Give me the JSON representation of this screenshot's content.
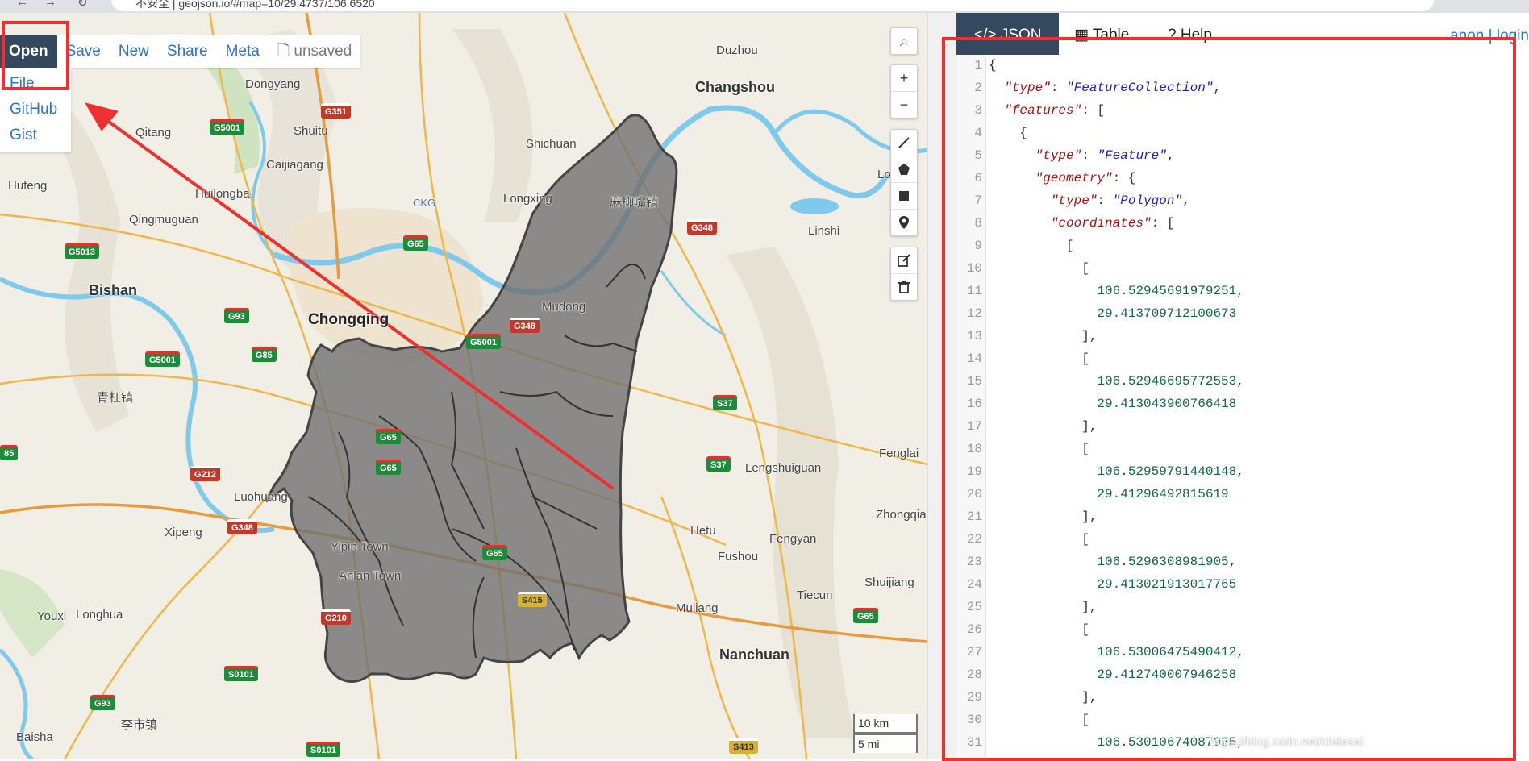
{
  "browser": {
    "url": "不安全 | geojson.io/#map=10/29.4737/106.6520"
  },
  "menu": {
    "open": "Open",
    "save": "Save",
    "new": "New",
    "share": "Share",
    "meta": "Meta",
    "unsaved": "unsaved"
  },
  "open_menu": {
    "items": [
      "File",
      "GitHub",
      "Gist"
    ]
  },
  "map": {
    "places": [
      {
        "label": "Changshou",
        "kind": "big"
      },
      {
        "label": "Chongqing",
        "kind": "city"
      },
      {
        "label": "Bishan",
        "kind": "big"
      },
      {
        "label": "Duzhou",
        "kind": "normal"
      },
      {
        "label": "Dongyang",
        "kind": "normal"
      },
      {
        "label": "Shuitu",
        "kind": "normal"
      },
      {
        "label": "Qitang",
        "kind": "normal"
      },
      {
        "label": "Caijiagang",
        "kind": "normal"
      },
      {
        "label": "Shichuan",
        "kind": "normal"
      },
      {
        "label": "Hufeng",
        "kind": "normal"
      },
      {
        "label": "Huilongba",
        "kind": "normal"
      },
      {
        "label": "Longxing",
        "kind": "normal"
      },
      {
        "label": "麻柳嘴镇",
        "kind": "normal"
      },
      {
        "label": "Qingmuguan",
        "kind": "normal"
      },
      {
        "label": "Linshi",
        "kind": "normal"
      },
      {
        "label": "Mudong",
        "kind": "normal"
      },
      {
        "label": "青杠镇",
        "kind": "normal"
      },
      {
        "label": "Fenglai",
        "kind": "normal"
      },
      {
        "label": "Lengshuiguan",
        "kind": "normal"
      },
      {
        "label": "Luohuang",
        "kind": "normal"
      },
      {
        "label": "Zhongqia",
        "kind": "normal"
      },
      {
        "label": "Xipeng",
        "kind": "normal"
      },
      {
        "label": "Hetu",
        "kind": "normal"
      },
      {
        "label": "Fengyan",
        "kind": "normal"
      },
      {
        "label": "Yipin Town",
        "kind": "normal"
      },
      {
        "label": "Fushou",
        "kind": "normal"
      },
      {
        "label": "Anlan Town",
        "kind": "normal"
      },
      {
        "label": "Shuijiang",
        "kind": "normal"
      },
      {
        "label": "Tiecun",
        "kind": "normal"
      },
      {
        "label": "Youxi",
        "kind": "normal"
      },
      {
        "label": "Longhua",
        "kind": "normal"
      },
      {
        "label": "Muliang",
        "kind": "normal"
      },
      {
        "label": "Nanchuan",
        "kind": "big"
      },
      {
        "label": "李市镇",
        "kind": "normal"
      },
      {
        "label": "Baisha",
        "kind": "normal"
      },
      {
        "label": "CKG",
        "kind": "normal"
      },
      {
        "label": "Lo",
        "kind": "normal"
      }
    ],
    "shields": [
      {
        "label": "G351",
        "kind": "r"
      },
      {
        "label": "G5001",
        "kind": "g"
      },
      {
        "label": "G65",
        "kind": "g"
      },
      {
        "label": "G348",
        "kind": "r"
      },
      {
        "label": "G5013",
        "kind": "g"
      },
      {
        "label": "G93",
        "kind": "g"
      },
      {
        "label": "G85",
        "kind": "g"
      },
      {
        "label": "G5001",
        "kind": "g"
      },
      {
        "label": "G5001",
        "kind": "g"
      },
      {
        "label": "G348",
        "kind": "r"
      },
      {
        "label": "S37",
        "kind": "g"
      },
      {
        "label": "G65",
        "kind": "g"
      },
      {
        "label": "S37",
        "kind": "g"
      },
      {
        "label": "G212",
        "kind": "r"
      },
      {
        "label": "G65",
        "kind": "g"
      },
      {
        "label": "G348",
        "kind": "r"
      },
      {
        "label": "G65",
        "kind": "g"
      },
      {
        "label": "S415",
        "kind": "y"
      },
      {
        "label": "G210",
        "kind": "r"
      },
      {
        "label": "G65",
        "kind": "g"
      },
      {
        "label": "S0101",
        "kind": "g"
      },
      {
        "label": "G93",
        "kind": "g"
      },
      {
        "label": "S0101",
        "kind": "g"
      },
      {
        "label": "S413",
        "kind": "y"
      },
      {
        "label": "85",
        "kind": "g"
      }
    ],
    "scale": {
      "km": "10 km",
      "mi": "5 mi"
    },
    "controls": {
      "search": "⌕",
      "zoom_in": "+",
      "zoom_out": "−"
    }
  },
  "panel": {
    "tabs": {
      "json": "JSON",
      "table": "Table",
      "help": "Help"
    },
    "tab_icons": {
      "json": "</>",
      "table": "▦",
      "help": "?"
    },
    "login": "anon | login",
    "lines": [
      {
        "n": "1",
        "text": "{"
      },
      {
        "n": "2",
        "text": "  \"type\": \"FeatureCollection\","
      },
      {
        "n": "3",
        "text": "  \"features\": ["
      },
      {
        "n": "4",
        "text": "    {"
      },
      {
        "n": "5",
        "text": "      \"type\": \"Feature\","
      },
      {
        "n": "6",
        "text": "      \"geometry\": {"
      },
      {
        "n": "7",
        "text": "        \"type\": \"Polygon\","
      },
      {
        "n": "8",
        "text": "        \"coordinates\": ["
      },
      {
        "n": "9",
        "text": "          ["
      },
      {
        "n": "10",
        "text": "            ["
      },
      {
        "n": "11",
        "text": "              106.52945691979251,"
      },
      {
        "n": "12",
        "text": "              29.413709712100673"
      },
      {
        "n": "13",
        "text": "            ],"
      },
      {
        "n": "14",
        "text": "            ["
      },
      {
        "n": "15",
        "text": "              106.52946695772553,"
      },
      {
        "n": "16",
        "text": "              29.413043900766418"
      },
      {
        "n": "17",
        "text": "            ],"
      },
      {
        "n": "18",
        "text": "            ["
      },
      {
        "n": "19",
        "text": "              106.52959791440148,"
      },
      {
        "n": "20",
        "text": "              29.41296492815619"
      },
      {
        "n": "21",
        "text": "            ],"
      },
      {
        "n": "22",
        "text": "            ["
      },
      {
        "n": "23",
        "text": "              106.5296308981905,"
      },
      {
        "n": "24",
        "text": "              29.413021913017765"
      },
      {
        "n": "25",
        "text": "            ],"
      },
      {
        "n": "26",
        "text": "            ["
      },
      {
        "n": "27",
        "text": "              106.53006475490412,"
      },
      {
        "n": "28",
        "text": "              29.412740007946258"
      },
      {
        "n": "29",
        "text": "            ],"
      },
      {
        "n": "30",
        "text": "            ["
      },
      {
        "n": "31",
        "text": "              106.53010674087925,"
      }
    ]
  },
  "watermark": "https://blog.csdn.net/chdasai",
  "colors": {
    "annotation": "#ee3030",
    "accent": "#2f74c0",
    "dark": "#34495e",
    "polygon": "#6e6e6e"
  }
}
